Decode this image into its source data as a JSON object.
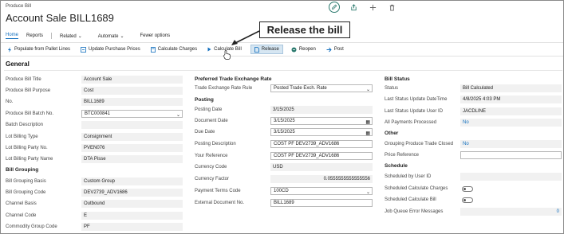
{
  "breadcrumb": "Produce Bill",
  "page_title": "Account Sale BILL1689",
  "actions": {
    "home": "Home",
    "reports": "Reports",
    "related": "Related",
    "automate": "Automate",
    "fewer": "Fewer options"
  },
  "toolbar": {
    "populate": "Populate from Pallet Lines",
    "update_prices": "Update Purchase Prices",
    "calc_charges": "Calculate Charges",
    "calc_bill": "Calculate Bill",
    "release": "Release",
    "reopen": "Reopen",
    "post": "Post"
  },
  "callout": "Release the bill",
  "section_title": "General",
  "col1": {
    "produce_bill_title": {
      "label": "Produce Bill Title",
      "value": "Account Sale"
    },
    "purpose": {
      "label": "Produce Bill Purpose",
      "value": "Cost"
    },
    "no": {
      "label": "No.",
      "value": "BILL1689"
    },
    "batch_no": {
      "label": "Produce Bill Batch No.",
      "value": "BTC000841"
    },
    "batch_desc": {
      "label": "Batch Description",
      "value": ""
    },
    "lot_billing_type": {
      "label": "Lot Billing Type",
      "value": "Consignment"
    },
    "lot_party_no": {
      "label": "Lot Billing Party No.",
      "value": "PVEN076"
    },
    "lot_party_name": {
      "label": "Lot Billing Party Name",
      "value": "DTA Pisse"
    },
    "bill_grouping": "Bill Grouping",
    "grouping_basis": {
      "label": "Bill Grouping Basis",
      "value": "Custom Group"
    },
    "grouping_code": {
      "label": "Bill Grouping Code",
      "value": "DEV2739_ADV1686"
    },
    "channel_basis": {
      "label": "Channel Basis",
      "value": "Outbound"
    },
    "channel_code": {
      "label": "Channel Code",
      "value": "E"
    },
    "commodity_group": {
      "label": "Commodity Group Code",
      "value": "PF"
    }
  },
  "col2": {
    "fx_title": "Preferred Trade Exchange Rate",
    "fx_rule": {
      "label": "Trade Exchange Rate Rule",
      "value": "Posted Trade Exch. Rate"
    },
    "posting": "Posting",
    "posting_date": {
      "label": "Posting Date",
      "value": "3/15/2025"
    },
    "document_date": {
      "label": "Document Date",
      "value": "3/15/2025"
    },
    "due_date": {
      "label": "Due Date",
      "value": "3/15/2025"
    },
    "posting_desc": {
      "label": "Posting Description",
      "value": "COST PF DEV2739_ADV1686"
    },
    "your_ref": {
      "label": "Your Reference",
      "value": "COST PF DEV2739_ADV1686"
    },
    "currency_code": {
      "label": "Currency Code",
      "value": "USD"
    },
    "currency_factor": {
      "label": "Currency Factor",
      "value": "0.0555555555555556"
    },
    "payment_terms": {
      "label": "Payment Terms Code",
      "value": "100CD"
    },
    "ext_doc": {
      "label": "External Document No.",
      "value": "BILL1689"
    }
  },
  "col3": {
    "bill_status": "Bill Status",
    "status": {
      "label": "Status",
      "value": "Bill Calculated"
    },
    "last_update": {
      "label": "Last Status Update DateTime",
      "value": "4/8/2025 4:03 PM"
    },
    "last_user": {
      "label": "Last Status Update User ID",
      "value": "JACDLINE"
    },
    "all_payments": {
      "label": "All Payments Processed",
      "value": "No"
    },
    "other": "Other",
    "grouping_closed": {
      "label": "Grouping Produce Trade Closed",
      "value": "No"
    },
    "price_ref": {
      "label": "Price Reference",
      "value": ""
    },
    "schedule": "Schedule",
    "scheduled_by": {
      "label": "Scheduled by User ID",
      "value": ""
    },
    "sched_charges": {
      "label": "Scheduled Calculate Charges"
    },
    "sched_bill": {
      "label": "Scheduled Calculate Bill"
    },
    "job_queue": {
      "label": "Job Queue Error Messages",
      "value": "0"
    }
  },
  "colors": {
    "accent": "#106ebe",
    "teal": "#2b7a6e",
    "highlight": "#d6e6f2"
  }
}
